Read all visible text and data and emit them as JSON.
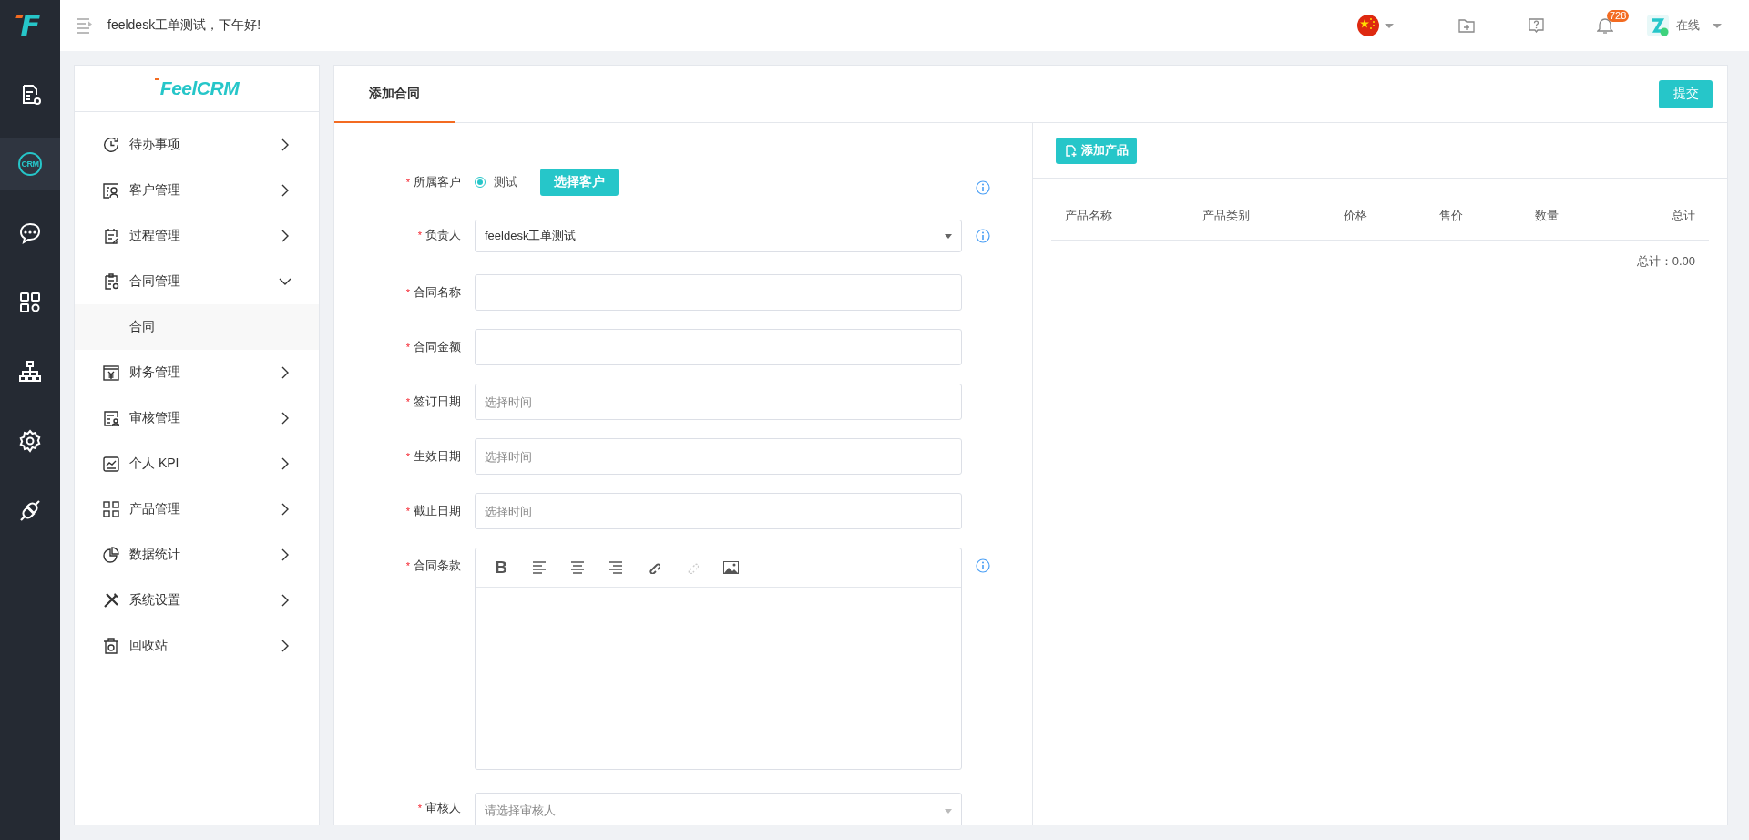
{
  "rail": {
    "logo": "F",
    "items": [
      {
        "selected": false
      },
      {
        "selected": true,
        "text": "CRM"
      },
      {
        "selected": false
      },
      {
        "selected": false
      },
      {
        "selected": false
      },
      {
        "selected": false
      },
      {
        "selected": false
      }
    ]
  },
  "header": {
    "greeting": "feeldesk工单测试，下午好!",
    "notifications": "728",
    "status": "在线"
  },
  "sidebar": {
    "logo": "FeelCRM",
    "items": [
      {
        "label": "待办事项",
        "expanded": false
      },
      {
        "label": "客户管理",
        "expanded": false
      },
      {
        "label": "过程管理",
        "expanded": false
      },
      {
        "label": "合同管理",
        "expanded": true,
        "children": [
          {
            "label": "合同",
            "selected": true
          }
        ]
      },
      {
        "label": "财务管理",
        "expanded": false
      },
      {
        "label": "审核管理",
        "expanded": false
      },
      {
        "label": "个人 KPI",
        "expanded": false
      },
      {
        "label": "产品管理",
        "expanded": false
      },
      {
        "label": "数据统计",
        "expanded": false
      },
      {
        "label": "系统设置",
        "expanded": false
      },
      {
        "label": "回收站",
        "expanded": false
      }
    ]
  },
  "tabs": [
    {
      "label": "添加合同",
      "selected": true
    }
  ],
  "submit": "提交",
  "form": {
    "fields": [
      {
        "kind": "radio",
        "required_mark": "*",
        "label": "所属客户",
        "option": "测试",
        "checked": true,
        "button": "选择客户",
        "info": true
      },
      {
        "kind": "select",
        "required_mark": "*",
        "label": "负责人",
        "value": "feeldesk工单测试",
        "info": true
      },
      {
        "kind": "text",
        "required_mark": "*",
        "label": "合同名称",
        "info": false
      },
      {
        "kind": "text",
        "required_mark": "*",
        "label": "合同金额",
        "info": false
      },
      {
        "kind": "text",
        "required_mark": "*",
        "label": "签订日期",
        "placeholder": "选择时间",
        "info": false
      },
      {
        "kind": "text",
        "required_mark": "*",
        "label": "生效日期",
        "placeholder": "选择时间",
        "info": false
      },
      {
        "kind": "text",
        "required_mark": "*",
        "label": "截止日期",
        "placeholder": "选择时间",
        "info": false
      },
      {
        "kind": "editor",
        "required_mark": "*",
        "label": "合同条款",
        "info": true,
        "toolbar": [
          {
            "kind": "bold",
            "text": "B",
            "disabled": false
          },
          {
            "kind": "align-left",
            "disabled": false
          },
          {
            "kind": "align-center",
            "disabled": false
          },
          {
            "kind": "align-right",
            "disabled": false
          },
          {
            "kind": "link",
            "disabled": false
          },
          {
            "kind": "unlink",
            "disabled": true
          },
          {
            "kind": "image",
            "disabled": false
          }
        ]
      },
      {
        "kind": "select",
        "required_mark": "*",
        "label": "审核人",
        "placeholder": "请选择审核人",
        "info": false
      }
    ]
  },
  "products": {
    "add_button": "添加产品",
    "columns": [
      "产品名称",
      "产品类别",
      "价格",
      "售价",
      "数量",
      "总计"
    ],
    "total": "总计：0.00"
  }
}
